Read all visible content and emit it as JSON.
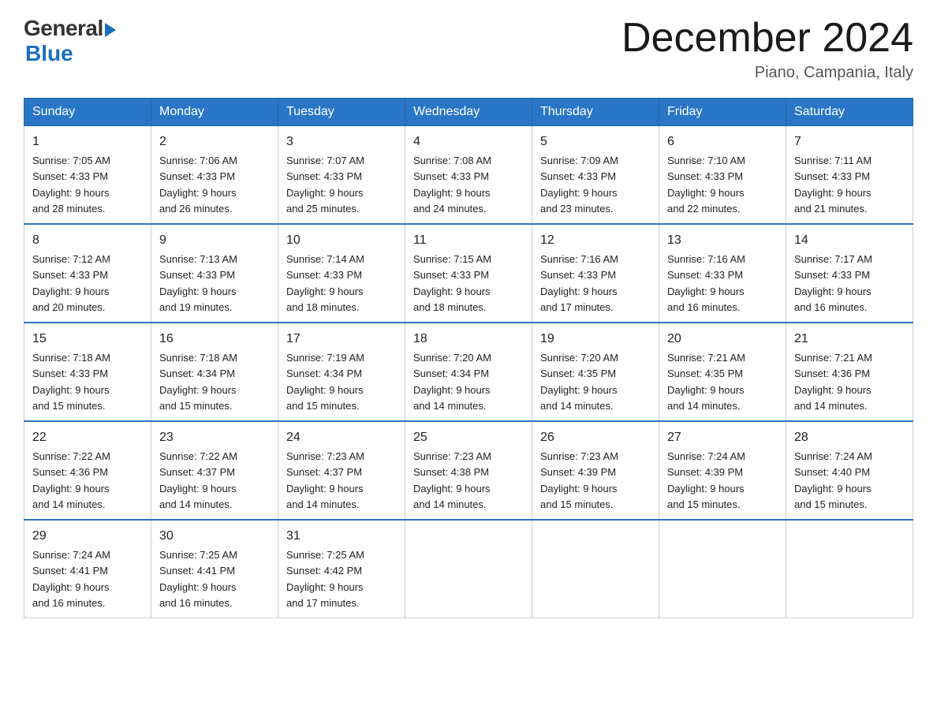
{
  "header": {
    "logo_general": "General",
    "logo_blue": "Blue",
    "month_title": "December 2024",
    "location": "Piano, Campania, Italy"
  },
  "days_of_week": [
    "Sunday",
    "Monday",
    "Tuesday",
    "Wednesday",
    "Thursday",
    "Friday",
    "Saturday"
  ],
  "weeks": [
    [
      {
        "day": "1",
        "sunrise": "7:05 AM",
        "sunset": "4:33 PM",
        "daylight": "9 hours and 28 minutes."
      },
      {
        "day": "2",
        "sunrise": "7:06 AM",
        "sunset": "4:33 PM",
        "daylight": "9 hours and 26 minutes."
      },
      {
        "day": "3",
        "sunrise": "7:07 AM",
        "sunset": "4:33 PM",
        "daylight": "9 hours and 25 minutes."
      },
      {
        "day": "4",
        "sunrise": "7:08 AM",
        "sunset": "4:33 PM",
        "daylight": "9 hours and 24 minutes."
      },
      {
        "day": "5",
        "sunrise": "7:09 AM",
        "sunset": "4:33 PM",
        "daylight": "9 hours and 23 minutes."
      },
      {
        "day": "6",
        "sunrise": "7:10 AM",
        "sunset": "4:33 PM",
        "daylight": "9 hours and 22 minutes."
      },
      {
        "day": "7",
        "sunrise": "7:11 AM",
        "sunset": "4:33 PM",
        "daylight": "9 hours and 21 minutes."
      }
    ],
    [
      {
        "day": "8",
        "sunrise": "7:12 AM",
        "sunset": "4:33 PM",
        "daylight": "9 hours and 20 minutes."
      },
      {
        "day": "9",
        "sunrise": "7:13 AM",
        "sunset": "4:33 PM",
        "daylight": "9 hours and 19 minutes."
      },
      {
        "day": "10",
        "sunrise": "7:14 AM",
        "sunset": "4:33 PM",
        "daylight": "9 hours and 18 minutes."
      },
      {
        "day": "11",
        "sunrise": "7:15 AM",
        "sunset": "4:33 PM",
        "daylight": "9 hours and 18 minutes."
      },
      {
        "day": "12",
        "sunrise": "7:16 AM",
        "sunset": "4:33 PM",
        "daylight": "9 hours and 17 minutes."
      },
      {
        "day": "13",
        "sunrise": "7:16 AM",
        "sunset": "4:33 PM",
        "daylight": "9 hours and 16 minutes."
      },
      {
        "day": "14",
        "sunrise": "7:17 AM",
        "sunset": "4:33 PM",
        "daylight": "9 hours and 16 minutes."
      }
    ],
    [
      {
        "day": "15",
        "sunrise": "7:18 AM",
        "sunset": "4:33 PM",
        "daylight": "9 hours and 15 minutes."
      },
      {
        "day": "16",
        "sunrise": "7:18 AM",
        "sunset": "4:34 PM",
        "daylight": "9 hours and 15 minutes."
      },
      {
        "day": "17",
        "sunrise": "7:19 AM",
        "sunset": "4:34 PM",
        "daylight": "9 hours and 15 minutes."
      },
      {
        "day": "18",
        "sunrise": "7:20 AM",
        "sunset": "4:34 PM",
        "daylight": "9 hours and 14 minutes."
      },
      {
        "day": "19",
        "sunrise": "7:20 AM",
        "sunset": "4:35 PM",
        "daylight": "9 hours and 14 minutes."
      },
      {
        "day": "20",
        "sunrise": "7:21 AM",
        "sunset": "4:35 PM",
        "daylight": "9 hours and 14 minutes."
      },
      {
        "day": "21",
        "sunrise": "7:21 AM",
        "sunset": "4:36 PM",
        "daylight": "9 hours and 14 minutes."
      }
    ],
    [
      {
        "day": "22",
        "sunrise": "7:22 AM",
        "sunset": "4:36 PM",
        "daylight": "9 hours and 14 minutes."
      },
      {
        "day": "23",
        "sunrise": "7:22 AM",
        "sunset": "4:37 PM",
        "daylight": "9 hours and 14 minutes."
      },
      {
        "day": "24",
        "sunrise": "7:23 AM",
        "sunset": "4:37 PM",
        "daylight": "9 hours and 14 minutes."
      },
      {
        "day": "25",
        "sunrise": "7:23 AM",
        "sunset": "4:38 PM",
        "daylight": "9 hours and 14 minutes."
      },
      {
        "day": "26",
        "sunrise": "7:23 AM",
        "sunset": "4:39 PM",
        "daylight": "9 hours and 15 minutes."
      },
      {
        "day": "27",
        "sunrise": "7:24 AM",
        "sunset": "4:39 PM",
        "daylight": "9 hours and 15 minutes."
      },
      {
        "day": "28",
        "sunrise": "7:24 AM",
        "sunset": "4:40 PM",
        "daylight": "9 hours and 15 minutes."
      }
    ],
    [
      {
        "day": "29",
        "sunrise": "7:24 AM",
        "sunset": "4:41 PM",
        "daylight": "9 hours and 16 minutes."
      },
      {
        "day": "30",
        "sunrise": "7:25 AM",
        "sunset": "4:41 PM",
        "daylight": "9 hours and 16 minutes."
      },
      {
        "day": "31",
        "sunrise": "7:25 AM",
        "sunset": "4:42 PM",
        "daylight": "9 hours and 17 minutes."
      },
      null,
      null,
      null,
      null
    ]
  ],
  "labels": {
    "sunrise": "Sunrise:",
    "sunset": "Sunset:",
    "daylight": "Daylight:"
  }
}
